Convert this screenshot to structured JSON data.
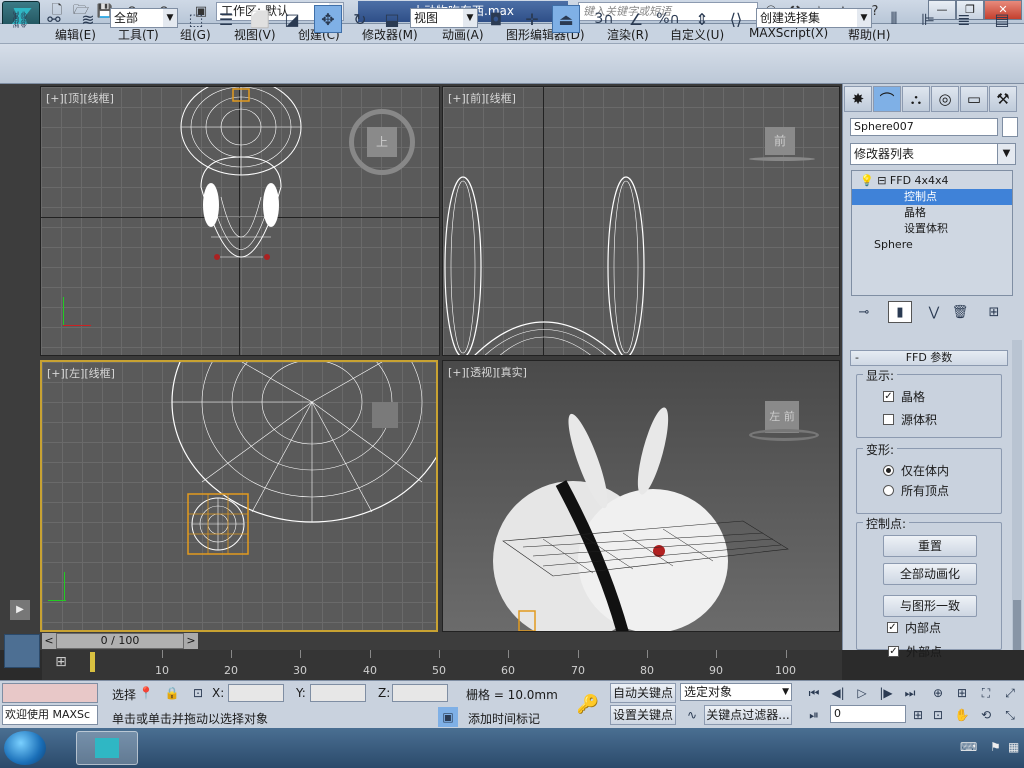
{
  "title_bar": {
    "workspace": "工作区: 默认",
    "document_title": "小动物吃东西.max",
    "search_placeholder": "键入关键字或短语"
  },
  "menu": {
    "items": [
      "编辑(E)",
      "工具(T)",
      "组(G)",
      "视图(V)",
      "创建(C)",
      "修改器(M)",
      "动画(A)",
      "图形编辑器(D)",
      "渲染(R)",
      "自定义(U)",
      "MAXScript(X)",
      "帮助(H)"
    ]
  },
  "toolbar": {
    "selection_filter": "全部",
    "ref_coord": "视图",
    "snap_value": "3",
    "percent_label": "%",
    "named_selection": "创建选择集"
  },
  "viewports": [
    {
      "label": "[+][顶][线框]",
      "nav_cube": "上"
    },
    {
      "label": "[+][前][线框]",
      "nav_cube": "前"
    },
    {
      "label": "[+][左][线框]",
      "nav_cube": ""
    },
    {
      "label": "[+][透视][真实]",
      "nav_cube": "左 前"
    }
  ],
  "command_panel": {
    "object_name": "Sphere007",
    "modifier_list": "修改器列表",
    "stack": [
      {
        "label": "FFD 4x4x4",
        "level": 0,
        "selected": false
      },
      {
        "label": "控制点",
        "level": 1,
        "selected": true
      },
      {
        "label": "晶格",
        "level": 1,
        "selected": false
      },
      {
        "label": "设置体积",
        "level": 1,
        "selected": false
      },
      {
        "label": "Sphere",
        "level": 0,
        "selected": false
      }
    ],
    "rollout_title": "FFD 参数",
    "display_group": "显示:",
    "display_lattice": "晶格",
    "display_lattice_checked": true,
    "display_source": "源体积",
    "display_source_checked": false,
    "deform_group": "变形:",
    "deform_inside": "仅在体内",
    "deform_all": "所有顶点",
    "deform_selected": "inside",
    "ctrl_group": "控制点:",
    "btn_reset": "重置",
    "btn_animate_all": "全部动画化",
    "btn_conform": "与图形一致",
    "inside_points": "内部点",
    "inside_points_checked": true,
    "outside_points": "外部点",
    "outside_points_checked": true
  },
  "timeline": {
    "frame_display": "0 / 100",
    "prev_label": "<",
    "next_label": ">",
    "ticks": [
      "10",
      "20",
      "30",
      "40",
      "50",
      "60",
      "70",
      "80",
      "90",
      "100"
    ]
  },
  "status": {
    "maxscript_prompt": "欢迎使用 MAXSc",
    "selected_label": "选择",
    "x_label": "X:",
    "y_label": "Y:",
    "z_label": "Z:",
    "grid_label": "栅格 = 10.0mm",
    "prompt_text": "单击或单击并拖动以选择对象",
    "add_time_tag": "添加时间标记",
    "auto_key": "自动关键点",
    "set_key": "设置关键点",
    "key_filter_select": "选定对象",
    "key_filters": "关键点过滤器...",
    "current_frame": "0"
  },
  "colors": {
    "active_viewport_border": "#c8a232",
    "stack_selection": "#3f82d8",
    "lattice_control_points": "#e29a1e"
  }
}
